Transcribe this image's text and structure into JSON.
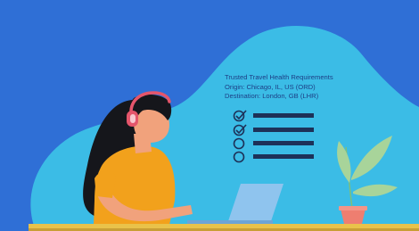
{
  "info": {
    "heading": "Trusted Travel Health Requirements",
    "origin": "Origin: Chicago, IL, US (ORD)",
    "destination": "Destination: London, GB (LHR)"
  },
  "checklist": {
    "items": [
      {
        "checked": true
      },
      {
        "checked": true
      },
      {
        "checked": false
      },
      {
        "checked": false
      }
    ]
  },
  "colors": {
    "background": "#2f6fd6",
    "blob": "#3bbce6",
    "desk": "#e9c24a",
    "shirt": "#f2a11c",
    "hair": "#15161b",
    "skin": "#f1a27c",
    "headphones": "#e4556b",
    "laptop": "#8fc4ee",
    "plant_pot": "#ee7e70",
    "leaves": "#a8d49a",
    "list_ink": "#1d3158"
  },
  "icons": [
    "headphones-icon",
    "laptop-icon",
    "plant-icon",
    "checkbox-checked-icon",
    "checkbox-empty-icon"
  ]
}
